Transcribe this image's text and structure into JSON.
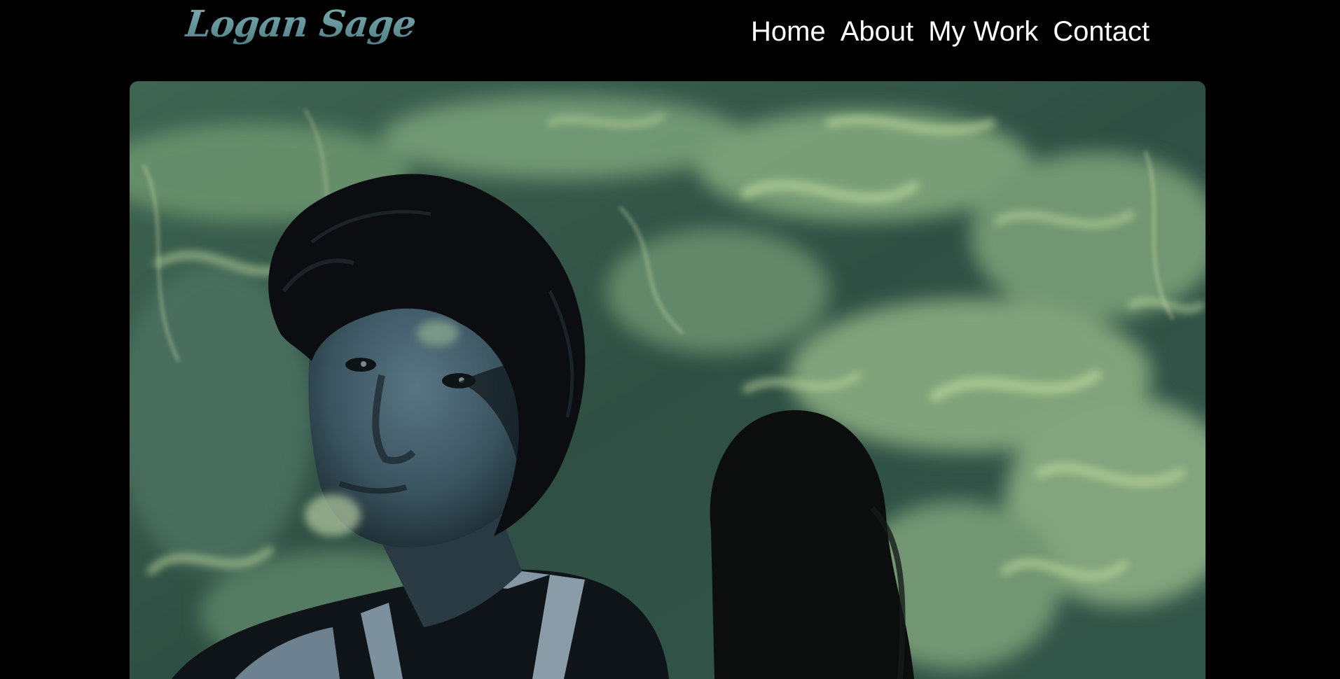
{
  "site": {
    "logo_text": "Logan Sage"
  },
  "nav": {
    "items": [
      {
        "label": "Home"
      },
      {
        "label": "About"
      },
      {
        "label": "My Work"
      },
      {
        "label": "Contact"
      }
    ]
  },
  "hero": {
    "icon": "hero-photo",
    "colors": {
      "water_dark": "#1e3a30",
      "water_mid": "#4f7a5e",
      "water_light": "#a9c98f",
      "skin": "#3e5964",
      "hair": "#0d0f12"
    }
  }
}
